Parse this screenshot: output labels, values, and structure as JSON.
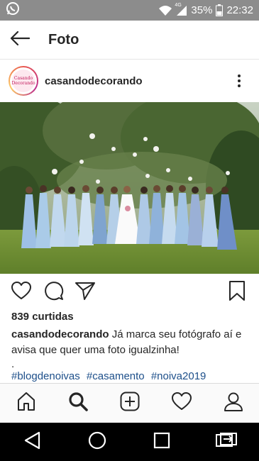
{
  "status_bar": {
    "network": "4G",
    "battery": "35%",
    "time": "22:32",
    "icons": [
      "whatsapp-icon",
      "wifi-icon",
      "signal-icon",
      "battery-icon"
    ]
  },
  "header": {
    "title": "Foto",
    "back_icon": "arrow-left-icon"
  },
  "post": {
    "username": "casandodecorando",
    "avatar_text": "Casando Decorando",
    "likes": "839 curtidas",
    "caption_user": "casandodecorando",
    "caption_text": "Já marca seu fotógrafo aí e avisa que quer uma foto igualzinha!",
    "caption_dot": ".",
    "hashtags": [
      "#blogdenoivas",
      "#casamento",
      "#noiva2019"
    ],
    "actions": [
      "heart-icon",
      "comment-icon",
      "share-icon",
      "bookmark-icon"
    ]
  },
  "tabbar": {
    "tabs": [
      "home",
      "search",
      "new-post",
      "activity",
      "profile"
    ],
    "active": "search"
  },
  "colors": {
    "status_bar_bg": "#8c8c8c",
    "hashtag": "#1d4f8a",
    "text": "#262626",
    "dress_blue": "#a8c4e0"
  }
}
